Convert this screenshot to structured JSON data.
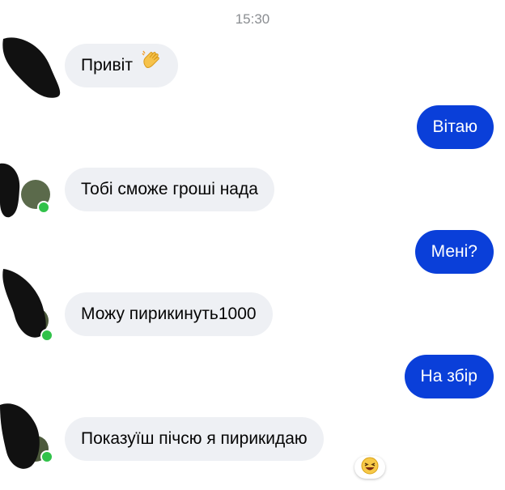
{
  "chat": {
    "timestamp": "15:30",
    "messages": [
      {
        "direction": "incoming",
        "text": "Привіт",
        "emoji": "waving-hand"
      },
      {
        "direction": "outgoing",
        "text": "Вітаю"
      },
      {
        "direction": "incoming",
        "text": "Тобі сможе гроші нада"
      },
      {
        "direction": "outgoing",
        "text": "Мені?"
      },
      {
        "direction": "incoming",
        "text": "Можу  пирикинуть1000"
      },
      {
        "direction": "outgoing",
        "text": "На збір"
      },
      {
        "direction": "incoming",
        "text": "Показуїш пічсю я пирикидаю",
        "reaction": "laughing-emoji"
      }
    ]
  },
  "colors": {
    "outgoing_bubble": "#0a3fd9",
    "incoming_bubble": "#eef0f4",
    "online": "#31c24a"
  }
}
